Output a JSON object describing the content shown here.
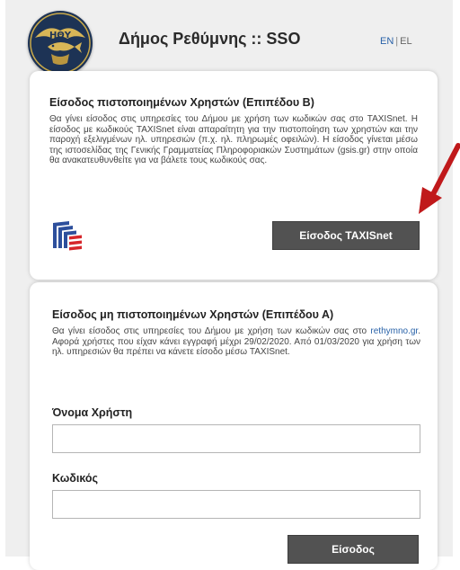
{
  "header": {
    "site_title": "Δήμος Ρεθύμνης :: SSO",
    "logo_text": "ΗΘΥ",
    "lang_en": "EN",
    "lang_sep": "|",
    "lang_el": "EL"
  },
  "taxisnet_login": {
    "title": "Είσοδος πιστοποιημένων Χρηστών (Επιπέδου Β)",
    "description": "Θα γίνει είσοδος στις υπηρεσίες του Δήμου με χρήση των κωδικών σας στο TAXISnet. Η είσοδος με κωδικούς TAXISnet είναι απαραίτητη για την πιστοποίηση των χρηστών και την παροχή εξελιγμένων ηλ. υπηρεσιών (π.χ. ηλ. πληρωμές οφειλών). Η είσοδος γίνεται μέσω της ιστοσελίδας της Γενικής Γραμματείας Πληροφοριακών Συστημάτων (gsis.gr) στην οποία θα ανακατευθυνθείτε για να βάλετε τους κωδικούς σας.",
    "button_label": "Είσοδος TAXISnet"
  },
  "local_login": {
    "title": "Είσοδος μη πιστοποιημένων Χρηστών (Επιπέδου Α)",
    "desc_before_link": "Θα γίνει είσοδος στις υπηρεσίες του Δήμου με χρήση των κωδικών σας στο ",
    "desc_link": "rethymno.gr",
    "desc_after_link": ". Αφορά χρήστες που είχαν κάνει εγγραφή μέχρι 29/02/2020. Από 01/03/2020 για χρήση των ηλ. υπηρεσιών θα πρέπει να κάνετε είσοδο μέσω TAXISnet.",
    "username_label": "Όνομα Χρήστη",
    "username_value": "",
    "password_label": "Κωδικός",
    "password_value": "",
    "submit_label": "Είσοδος"
  },
  "colors": {
    "button_bg": "#525252",
    "link": "#2962a8",
    "arrow": "#c0191b",
    "logo_bg": "#1d3355"
  },
  "icons": {
    "logo": "municipality-seal",
    "gsis": "gsis-logo",
    "annotation": "red-arrow"
  }
}
